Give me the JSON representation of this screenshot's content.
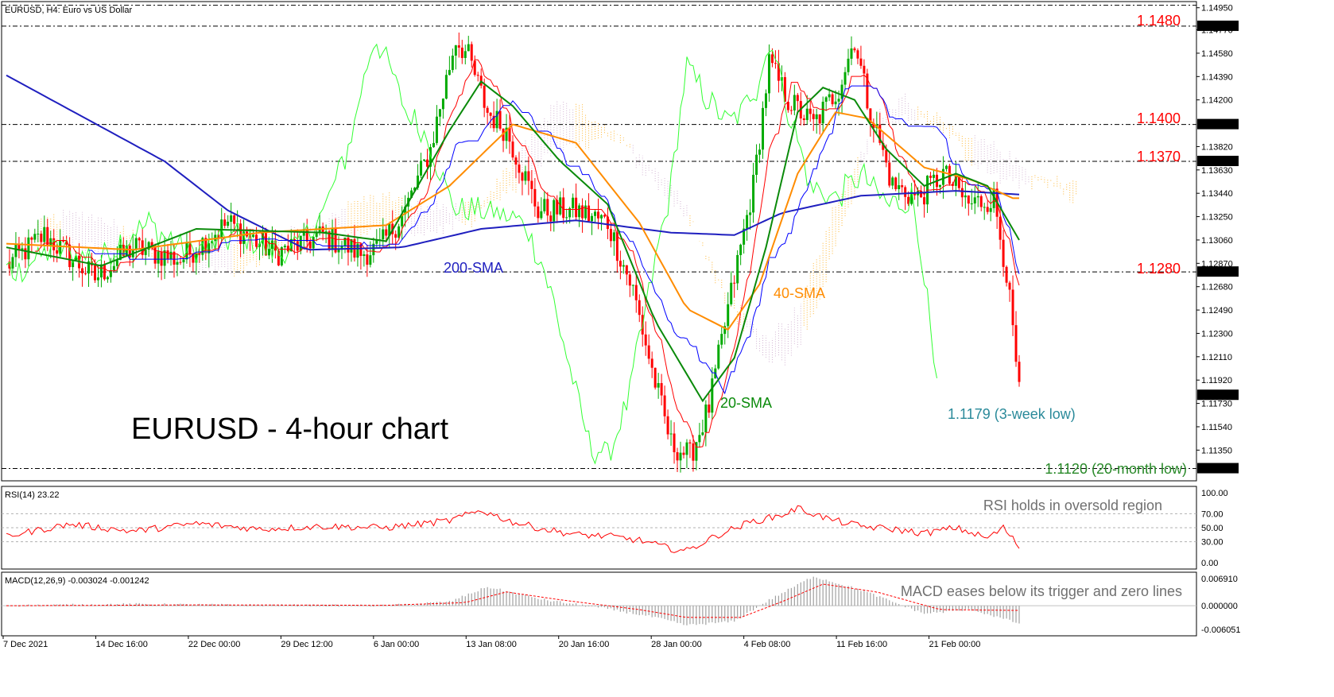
{
  "header": {
    "main": "EURUSD, H4:  Euro vs US Dollar",
    "rsi": "RSI(14) 23.22",
    "macd": "MACD(12,26,9) -0.003024 -0.001242"
  },
  "title": "EURUSD - 4-hour chart",
  "colors": {
    "up": "#00aa00",
    "down": "#ff0000",
    "sma200": "#1f1fbf",
    "sma40": "#ff8c00",
    "sma20": "#0a8a0a",
    "tenkan": "#ff0000",
    "kijun": "#0000ff",
    "chikou": "#33ff33",
    "cloud_bull": "#ffa500",
    "cloud_bear": "#c8a2c8",
    "rsi": "#ff0000",
    "macd_hist": "#a0a0a0",
    "macd_signal": "#ff0000"
  },
  "chart_data": [
    {
      "type": "candlestick",
      "title": "EURUSD, H4:  Euro vs US Dollar",
      "ylim": [
        1.111,
        1.15
      ],
      "y_ticks": [
        "1.14950",
        "1.14770",
        "1.14580",
        "1.14390",
        "1.14200",
        "1.13820",
        "1.13630",
        "1.13440",
        "1.13250",
        "1.13060",
        "1.12870",
        "1.12680",
        "1.12490",
        "1.12300",
        "1.12110",
        "1.11920",
        "1.11730",
        "1.11540",
        "1.11350"
      ],
      "price_tags": [
        {
          "value": "1.14800",
          "level": 1.148
        },
        {
          "value": "1.14000",
          "level": 1.14
        },
        {
          "value": "1.13700",
          "level": 1.137
        },
        {
          "value": "1.12800",
          "level": 1.128
        },
        {
          "value": "1.11797",
          "level": 1.11797
        },
        {
          "value": "1.11200",
          "level": 1.112
        }
      ],
      "x_labels": [
        "7 Dec 2021",
        "14 Dec 16:00",
        "22 Dec 00:00",
        "29 Dec 12:00",
        "6 Jan 00:00",
        "13 Jan 08:00",
        "20 Jan 16:00",
        "28 Jan 00:00",
        "4 Feb 08:00",
        "11 Feb 16:00",
        "21 Feb 00:00"
      ],
      "levels": [
        {
          "label": "1.1480",
          "value": 1.148
        },
        {
          "label": "1.1400",
          "value": 1.14
        },
        {
          "label": "1.1370",
          "value": 1.137
        },
        {
          "label": "1.1280",
          "value": 1.128
        },
        {
          "label": "1.1120 (20-month low)",
          "value": 1.112
        }
      ],
      "annotations": [
        {
          "text": "200-SMA",
          "color": "#1f1fbf"
        },
        {
          "text": "40-SMA",
          "color": "#ff8c00"
        },
        {
          "text": "20-SMA",
          "color": "#0a8a0a"
        },
        {
          "text": "1.1179 (3-week low)",
          "color": "#2a8a9a"
        }
      ],
      "anchors": [
        [
          0,
          1.1285
        ],
        [
          12,
          1.131
        ],
        [
          28,
          1.1275
        ],
        [
          40,
          1.13
        ],
        [
          55,
          1.129
        ],
        [
          70,
          1.132
        ],
        [
          85,
          1.1295
        ],
        [
          100,
          1.131
        ],
        [
          112,
          1.1295
        ],
        [
          118,
          1.13
        ],
        [
          126,
          1.133
        ],
        [
          134,
          1.138
        ],
        [
          142,
          1.147
        ],
        [
          146,
          1.1455
        ],
        [
          152,
          1.141
        ],
        [
          158,
          1.1395
        ],
        [
          168,
          1.133
        ],
        [
          180,
          1.133
        ],
        [
          190,
          1.132
        ],
        [
          198,
          1.1265
        ],
        [
          204,
          1.12
        ],
        [
          210,
          1.114
        ],
        [
          216,
          1.113
        ],
        [
          222,
          1.117
        ],
        [
          228,
          1.125
        ],
        [
          236,
          1.135
        ],
        [
          241,
          1.145
        ],
        [
          247,
          1.142
        ],
        [
          255,
          1.14
        ],
        [
          263,
          1.143
        ],
        [
          268,
          1.147
        ],
        [
          272,
          1.142
        ],
        [
          280,
          1.135
        ],
        [
          288,
          1.134
        ],
        [
          296,
          1.136
        ],
        [
          304,
          1.1335
        ],
        [
          312,
          1.134
        ],
        [
          316,
          1.128
        ],
        [
          320,
          1.118
        ]
      ],
      "series": [
        {
          "name": "200-SMA",
          "values": [
            [
              0,
              1.144
            ],
            [
              25,
              1.1405
            ],
            [
              50,
              1.137
            ],
            [
              70,
              1.133
            ],
            [
              95,
              1.1298
            ],
            [
              125,
              1.13
            ],
            [
              150,
              1.1315
            ],
            [
              180,
              1.1322
            ],
            [
              210,
              1.1312
            ],
            [
              230,
              1.131
            ],
            [
              245,
              1.1328
            ],
            [
              270,
              1.1342
            ],
            [
              300,
              1.1346
            ],
            [
              320,
              1.1343
            ]
          ]
        },
        {
          "name": "40-SMA",
          "values": [
            [
              0,
              1.1303
            ],
            [
              40,
              1.1298
            ],
            [
              80,
              1.1312
            ],
            [
              120,
              1.1318
            ],
            [
              140,
              1.135
            ],
            [
              160,
              1.14
            ],
            [
              180,
              1.1385
            ],
            [
              200,
              1.132
            ],
            [
              215,
              1.125
            ],
            [
              228,
              1.1233
            ],
            [
              238,
              1.127
            ],
            [
              250,
              1.136
            ],
            [
              262,
              1.141
            ],
            [
              272,
              1.1405
            ],
            [
              290,
              1.1365
            ],
            [
              305,
              1.1355
            ],
            [
              318,
              1.134
            ]
          ]
        },
        {
          "name": "20-SMA",
          "values": [
            [
              0,
              1.13
            ],
            [
              30,
              1.1285
            ],
            [
              60,
              1.1315
            ],
            [
              100,
              1.1312
            ],
            [
              120,
              1.1305
            ],
            [
              140,
              1.1395
            ],
            [
              150,
              1.1435
            ],
            [
              160,
              1.1415
            ],
            [
              175,
              1.137
            ],
            [
              190,
              1.1335
            ],
            [
              205,
              1.124
            ],
            [
              220,
              1.1175
            ],
            [
              230,
              1.121
            ],
            [
              240,
              1.13
            ],
            [
              250,
              1.141
            ],
            [
              258,
              1.143
            ],
            [
              268,
              1.142
            ],
            [
              278,
              1.138
            ],
            [
              290,
              1.135
            ],
            [
              300,
              1.136
            ],
            [
              310,
              1.135
            ],
            [
              320,
              1.1306
            ]
          ]
        }
      ]
    },
    {
      "type": "line",
      "title": "RSI(14) 23.22",
      "ylim": [
        0,
        100
      ],
      "y_ticks": [
        "100.00",
        "70.00",
        "50.00",
        "30.00",
        "0.00"
      ],
      "annotation": "RSI holds in oversold region",
      "x": [
        0,
        20,
        40,
        60,
        80,
        100,
        120,
        140,
        150,
        160,
        170,
        180,
        190,
        200,
        210,
        215,
        225,
        235,
        245,
        250,
        260,
        270,
        280,
        290,
        300,
        310,
        315,
        320
      ],
      "values": [
        38,
        55,
        45,
        56,
        48,
        52,
        50,
        60,
        75,
        58,
        48,
        40,
        38,
        32,
        20,
        17,
        40,
        58,
        68,
        78,
        62,
        52,
        48,
        42,
        50,
        35,
        50,
        23
      ]
    },
    {
      "type": "bar",
      "title": "MACD(12,26,9) -0.003024 -0.001242",
      "ylim": [
        -0.006051,
        0.00691
      ],
      "y_ticks": [
        "0.006910",
        "0.000000",
        "-0.006051"
      ],
      "annotation": "MACD eases below its trigger and zero lines",
      "anchors": [
        [
          0,
          0.0
        ],
        [
          40,
          0.0004
        ],
        [
          80,
          0.0001
        ],
        [
          120,
          0.0
        ],
        [
          140,
          0.001
        ],
        [
          152,
          0.0048
        ],
        [
          170,
          0.0015
        ],
        [
          190,
          -0.0008
        ],
        [
          205,
          -0.003
        ],
        [
          215,
          -0.005
        ],
        [
          230,
          -0.004
        ],
        [
          240,
          0.001
        ],
        [
          255,
          0.0075
        ],
        [
          270,
          0.004
        ],
        [
          290,
          -0.002
        ],
        [
          305,
          -0.001
        ],
        [
          320,
          -0.0045
        ]
      ],
      "signal_anchors": [
        [
          0,
          0.0
        ],
        [
          60,
          0.0002
        ],
        [
          120,
          0.0001
        ],
        [
          145,
          0.0008
        ],
        [
          158,
          0.0035
        ],
        [
          175,
          0.0015
        ],
        [
          200,
          -0.001
        ],
        [
          215,
          -0.003
        ],
        [
          232,
          -0.003
        ],
        [
          245,
          0.001
        ],
        [
          258,
          0.0055
        ],
        [
          275,
          0.0035
        ],
        [
          295,
          -0.001
        ],
        [
          320,
          -0.0012
        ]
      ]
    }
  ]
}
